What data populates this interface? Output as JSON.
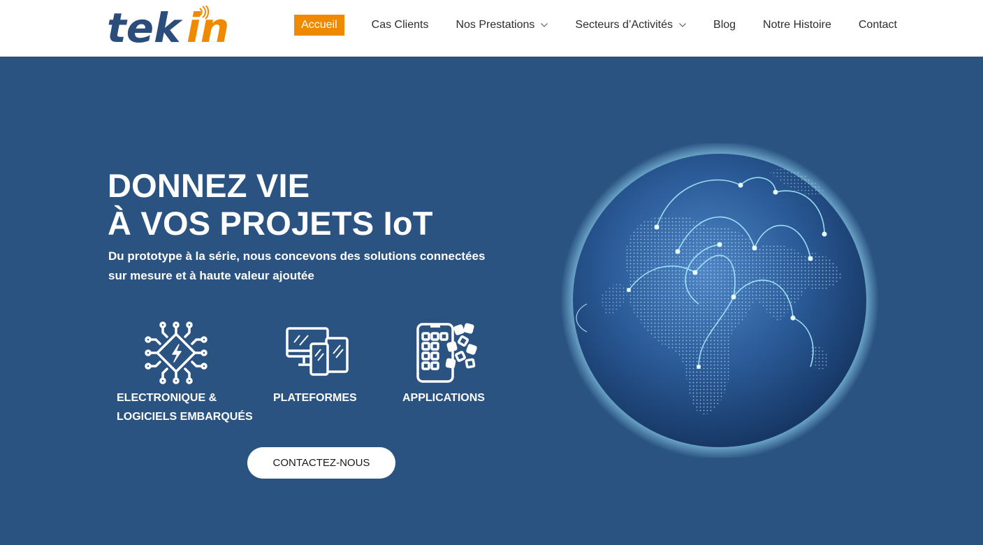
{
  "header": {
    "logo": {
      "part1": "tek",
      "part2": "in"
    },
    "nav": [
      {
        "label": "Accueil",
        "active": true,
        "dropdown": false
      },
      {
        "label": "Cas Clients",
        "active": false,
        "dropdown": false
      },
      {
        "label": "Nos Prestations",
        "active": false,
        "dropdown": true
      },
      {
        "label": "Secteurs d’Activités",
        "active": false,
        "dropdown": true
      },
      {
        "label": "Blog",
        "active": false,
        "dropdown": false
      },
      {
        "label": "Notre Histoire",
        "active": false,
        "dropdown": false
      },
      {
        "label": "Contact",
        "active": false,
        "dropdown": false
      }
    ]
  },
  "hero": {
    "title_line1": "DONNEZ VIE",
    "title_line2": "À VOS PROJETS IoT",
    "subtitle_line1": "Du prototype à la série, nous concevons des solutions connectées",
    "subtitle_line2": "sur mesure et à haute valeur ajoutée",
    "features": [
      {
        "icon": "chip-icon",
        "line1": "ELECTRONIQUE &",
        "line2": "LOGICIELS EMBARQUÉS"
      },
      {
        "icon": "devices-icon",
        "line1": "PLATEFORMES"
      },
      {
        "icon": "apps-icon",
        "line1": "APPLICATIONS"
      }
    ],
    "cta_label": "CONTACTEZ-NOUS",
    "image": "globe-network-icon"
  },
  "colors": {
    "brand_blue": "#2a5382",
    "brand_orange": "#ef8a00",
    "logo_blue": "#2b4d7b",
    "white": "#ffffff"
  }
}
